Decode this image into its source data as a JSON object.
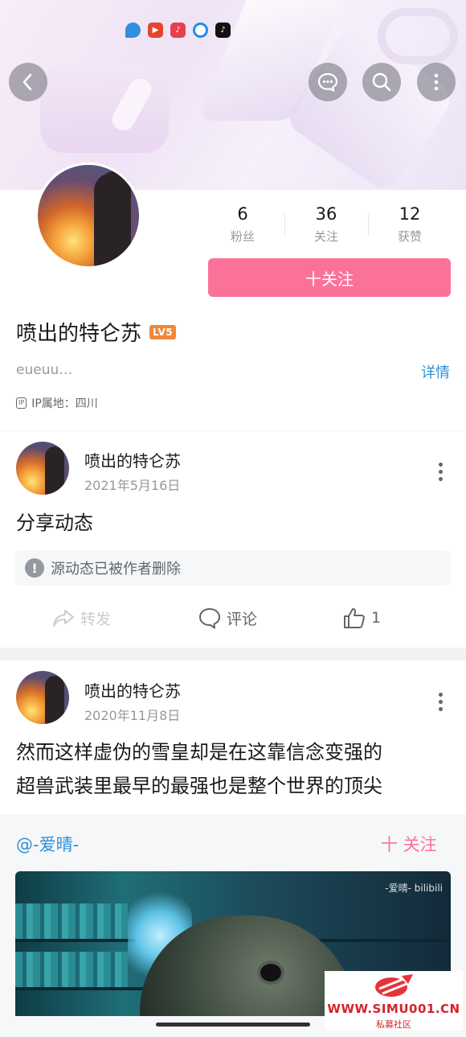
{
  "header": {
    "brand_icons": [
      "weixin-channels-icon",
      "youtube-icon",
      "music-icon",
      "edge-browser-icon",
      "tiktok-icon"
    ]
  },
  "profile": {
    "stats": [
      {
        "num": "6",
        "label": "粉丝"
      },
      {
        "num": "36",
        "label": "关注"
      },
      {
        "num": "12",
        "label": "获赞"
      }
    ],
    "follow_label": "十关注",
    "nickname": "喷出的特仑苏",
    "level": "LV5",
    "sign": "eueuu…",
    "detail_label": "详情",
    "ip_tag": "IP",
    "ip_location": "IP属地：四川"
  },
  "posts": [
    {
      "author": "喷出的特仑苏",
      "date": "2021年5月16日",
      "text": "分享动态",
      "deleted_notice": "源动态已被作者删除",
      "actions": {
        "forward": "转发",
        "comment": "评论",
        "like_count": "1"
      }
    },
    {
      "author": "喷出的特仑苏",
      "date": "2020年11月8日",
      "text_line1": "然而这样虚伪的雪皇却是在这靠信念变强的",
      "text_line2": "超兽武装里最早的最强也是整个世界的顶尖",
      "repost": {
        "author": "@-爱晴-",
        "follow_label": "十 关注",
        "watermark": "-爱晴- bilibili"
      }
    }
  ],
  "stamp": {
    "url": "WWW.SIMU001.CN",
    "name": "私募社区"
  },
  "colors": {
    "accent_pink": "#fb7299",
    "link_blue": "#2b90d9",
    "stamp_red": "#d3232b"
  }
}
